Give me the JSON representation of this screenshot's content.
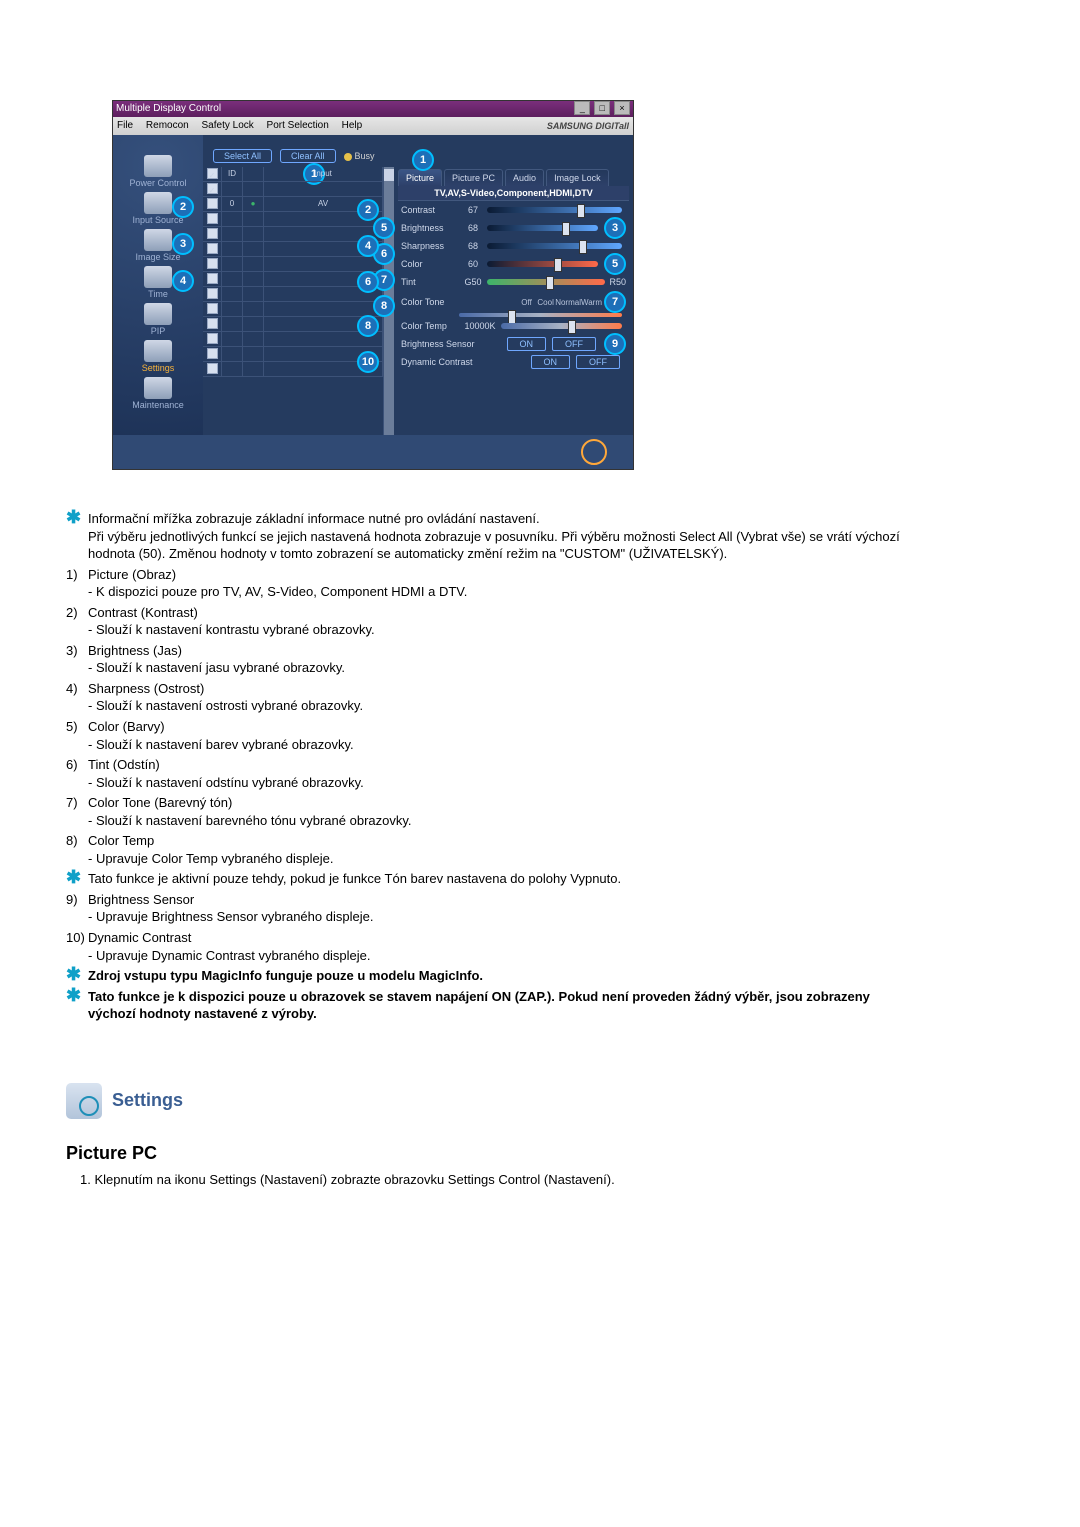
{
  "app": {
    "title": "Multiple Display Control",
    "menu": [
      "File",
      "Remocon",
      "Safety Lock",
      "Port Selection",
      "Help"
    ],
    "brand": "SAMSUNG DIGITall",
    "toolbar": {
      "select_all": "Select All",
      "clear_all": "Clear All",
      "busy": "Busy"
    },
    "sidebar": [
      {
        "label": "Power Control"
      },
      {
        "label": "Input Source"
      },
      {
        "label": "Image Size"
      },
      {
        "label": "Time"
      },
      {
        "label": "PIP"
      },
      {
        "label": "Settings",
        "active": true
      },
      {
        "label": "Maintenance"
      }
    ],
    "grid": {
      "headers": [
        "",
        "ID",
        "",
        "Input"
      ],
      "rows": [
        {
          "checked": true,
          "id": "",
          "st": "",
          "input": ""
        },
        {
          "checked": false,
          "id": "0",
          "st": "●",
          "input": "AV"
        },
        {
          "checked": false,
          "id": "",
          "st": "",
          "input": ""
        },
        {
          "checked": false,
          "id": "",
          "st": "",
          "input": ""
        },
        {
          "checked": false,
          "id": "",
          "st": "",
          "input": ""
        },
        {
          "checked": false,
          "id": "",
          "st": "",
          "input": ""
        },
        {
          "checked": false,
          "id": "",
          "st": "",
          "input": ""
        },
        {
          "checked": false,
          "id": "",
          "st": "",
          "input": ""
        },
        {
          "checked": false,
          "id": "",
          "st": "",
          "input": ""
        },
        {
          "checked": false,
          "id": "",
          "st": "",
          "input": ""
        },
        {
          "checked": false,
          "id": "",
          "st": "",
          "input": ""
        },
        {
          "checked": false,
          "id": "",
          "st": "",
          "input": ""
        },
        {
          "checked": false,
          "id": "",
          "st": "",
          "input": ""
        }
      ]
    },
    "tabs": [
      "Picture",
      "Picture PC",
      "Audio",
      "Image Lock"
    ],
    "sub": "TV,AV,S-Video,Component,HDMI,DTV",
    "sliders": {
      "contrast": {
        "lbl": "Contrast",
        "val": "67"
      },
      "brightness": {
        "lbl": "Brightness",
        "val": "68"
      },
      "sharpness": {
        "lbl": "Sharpness",
        "val": "68"
      },
      "color": {
        "lbl": "Color",
        "val": "60"
      },
      "tint": {
        "lbl": "Tint",
        "left": "G50",
        "right": "R50"
      },
      "colortone": {
        "lbl": "Color Tone",
        "opts": [
          "Off",
          "Cool",
          "Normal",
          "Warm"
        ]
      },
      "colortemp": {
        "lbl": "Color Temp",
        "val": "10000K"
      },
      "brsensor": {
        "lbl": "Brightness Sensor"
      },
      "dyncon": {
        "lbl": "Dynamic Contrast"
      }
    },
    "on": "ON",
    "off": "OFF",
    "callouts_sidebar": [
      "2",
      "3",
      "4"
    ],
    "callouts_grid": [
      "1",
      "5",
      "6",
      "7",
      "8"
    ],
    "callouts_panel": [
      "1",
      "2",
      "3",
      "4",
      "5",
      "6",
      "7",
      "8",
      "9",
      "10"
    ]
  },
  "doc": {
    "intro": {
      "star": "Informační mřížka zobrazuje základní informace nutné pro ovládání nastavení.",
      "star2": "Při výběru jednotlivých funkcí se jejich nastavená hodnota zobrazuje v posuvníku. Při výběru možnosti Select All (Vybrat vše) se vrátí výchozí hodnota (50). Změnou hodnoty v tomto zobrazení se automaticky změní režim na \"CUSTOM\" (UŽIVATELSKÝ)."
    },
    "items": [
      {
        "n": "1)",
        "t": "Picture (Obraz)",
        "d": "- K dispozici pouze pro TV, AV, S-Video, Component HDMI a DTV."
      },
      {
        "n": "2)",
        "t": "Contrast (Kontrast)",
        "d": "- Slouží k nastavení kontrastu vybrané obrazovky."
      },
      {
        "n": "3)",
        "t": "Brightness (Jas)",
        "d": "- Slouží k nastavení jasu vybrané obrazovky."
      },
      {
        "n": "4)",
        "t": "Sharpness (Ostrost)",
        "d": "- Slouží k nastavení ostrosti vybrané obrazovky."
      },
      {
        "n": "5)",
        "t": "Color (Barvy)",
        "d": "- Slouží k nastavení barev vybrané obrazovky."
      },
      {
        "n": "6)",
        "t": "Tint (Odstín)",
        "d": "- Slouží k nastavení odstínu vybrané obrazovky."
      },
      {
        "n": "7)",
        "t": "Color Tone (Barevný tón)",
        "d": "- Slouží k nastavení barevného tónu vybrané obrazovky."
      },
      {
        "n": "8)",
        "t": "Color Temp",
        "d": "- Upravuje Color Temp vybraného displeje."
      }
    ],
    "star_mid": "Tato funkce je aktivní pouze tehdy, pokud je funkce Tón barev nastavena do polohy Vypnuto.",
    "items2": [
      {
        "n": "9)",
        "t": "Brightness Sensor",
        "d": "- Upravuje Brightness Sensor vybraného displeje."
      },
      {
        "n": "10)",
        "t": "Dynamic Contrast",
        "d": "- Upravuje Dynamic Contrast vybraného displeje."
      }
    ],
    "stars_bold": [
      "Zdroj vstupu typu MagicInfo funguje pouze u modelu MagicInfo.",
      "Tato funkce je k dispozici pouze u obrazovek se stavem napájení ON (ZAP.). Pokud není proveden žádný výběr, jsou zobrazeny výchozí hodnoty nastavené z výroby."
    ],
    "settings_head": "Settings",
    "subhead": "Picture PC",
    "numitem": "1.  Klepnutím na ikonu Settings (Nastavení) zobrazte obrazovku Settings Control (Nastavení)."
  }
}
